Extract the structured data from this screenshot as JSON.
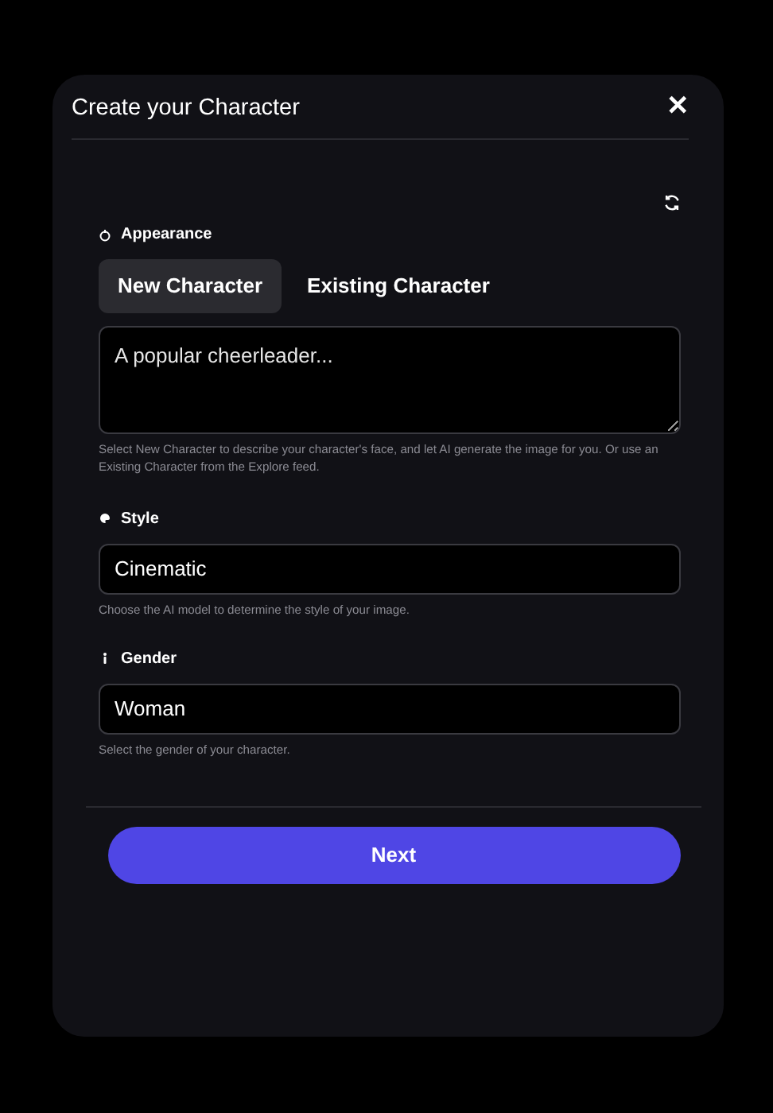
{
  "dialog": {
    "title": "Create your Character",
    "close": "✕"
  },
  "appearance": {
    "label": "Appearance",
    "tabs": [
      {
        "label": "New Character",
        "selected": true
      },
      {
        "label": "Existing Character",
        "selected": false
      }
    ],
    "description": {
      "placeholder": "A popular cheerleader..."
    },
    "help": "Select New Character to describe your character's face, and let AI generate the image for you. Or use an Existing Character from the Explore feed."
  },
  "fields": [
    {
      "kind": "style",
      "label": "Style",
      "value": "Cinematic",
      "help": "Choose the AI model to determine the style of your image."
    },
    {
      "kind": "gender",
      "label": "Gender",
      "value": "Woman",
      "help": "Select the gender of your character."
    }
  ],
  "next_button": "Next"
}
